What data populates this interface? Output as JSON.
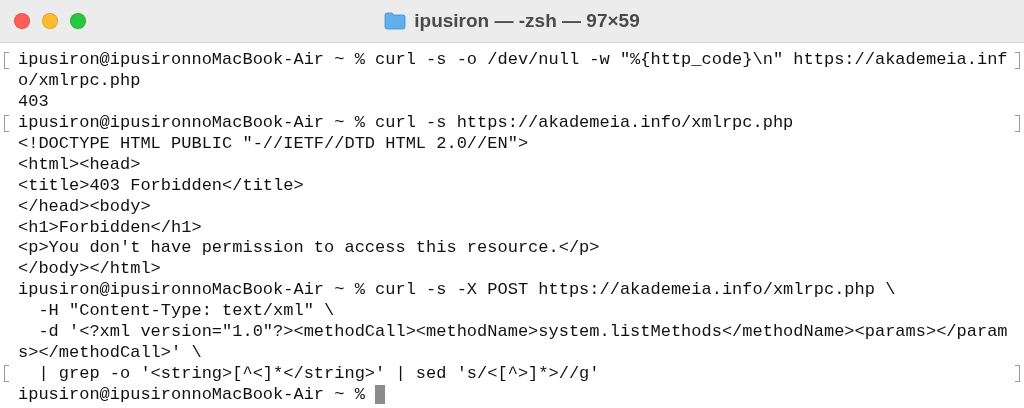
{
  "window": {
    "title": "ipusiron — -zsh — 97×59"
  },
  "lines": [
    {
      "text": "ipusiron@ipusironnoMacBook-Air ~ % curl -s -o /dev/null -w \"%{http_code}\\n\" https://akademeia.inf",
      "marked": true,
      "cursor": false
    },
    {
      "text": "o/xmlrpc.php",
      "marked": false,
      "cursor": false
    },
    {
      "text": "403",
      "marked": false,
      "cursor": false
    },
    {
      "text": "ipusiron@ipusironnoMacBook-Air ~ % curl -s https://akademeia.info/xmlrpc.php",
      "marked": true,
      "cursor": false
    },
    {
      "text": "<!DOCTYPE HTML PUBLIC \"-//IETF//DTD HTML 2.0//EN\">",
      "marked": false,
      "cursor": false
    },
    {
      "text": "<html><head>",
      "marked": false,
      "cursor": false
    },
    {
      "text": "<title>403 Forbidden</title>",
      "marked": false,
      "cursor": false
    },
    {
      "text": "</head><body>",
      "marked": false,
      "cursor": false
    },
    {
      "text": "<h1>Forbidden</h1>",
      "marked": false,
      "cursor": false
    },
    {
      "text": "<p>You don't have permission to access this resource.</p>",
      "marked": false,
      "cursor": false
    },
    {
      "text": "</body></html>",
      "marked": false,
      "cursor": false
    },
    {
      "text": "ipusiron@ipusironnoMacBook-Air ~ % curl -s -X POST https://akademeia.info/xmlrpc.php \\",
      "marked": false,
      "cursor": false
    },
    {
      "text": "  -H \"Content-Type: text/xml\" \\",
      "marked": false,
      "cursor": false
    },
    {
      "text": "  -d '<?xml version=\"1.0\"?><methodCall><methodName>system.listMethods</methodName><params></param",
      "marked": false,
      "cursor": false
    },
    {
      "text": "s></methodCall>' \\",
      "marked": false,
      "cursor": false
    },
    {
      "text": "  | grep -o '<string>[^<]*</string>' | sed 's/<[^>]*>//g'",
      "marked": true,
      "cursor": false
    },
    {
      "text": "ipusiron@ipusironnoMacBook-Air ~ %",
      "marked": false,
      "cursor": true
    }
  ]
}
